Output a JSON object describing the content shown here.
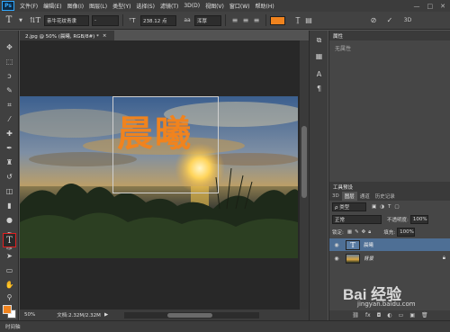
{
  "menu": {
    "logo": "Ps",
    "items": [
      "文件(F)",
      "编辑(E)",
      "图像(I)",
      "图层(L)",
      "类型(Y)",
      "选择(S)",
      "滤镜(T)",
      "3D(D)",
      "视图(V)",
      "窗口(W)",
      "帮助(H)"
    ]
  },
  "options": {
    "font_family": "亲牛花纹青隶",
    "font_style": "-",
    "font_size": "238.12 点",
    "antialias": "浑厚",
    "text_color": "#f0831e"
  },
  "document": {
    "tab_title": "2.jpg @ 50% (晨曦, RGB/8#) *",
    "text_layer": "晨曦",
    "zoom": "50%",
    "doc_info": "文档:2.32M/2.32M"
  },
  "properties": {
    "title": "属性",
    "empty_text": "无属性"
  },
  "layers_panel": {
    "preset_tab": "工具预设",
    "tabs": [
      "3D",
      "图层",
      "通道",
      "历史记录"
    ],
    "filter_label": "ρ 类型",
    "blend_mode": "正常",
    "opacity_label": "不透明度:",
    "opacity_value": "100%",
    "lock_label": "锁定:",
    "fill_label": "填充:",
    "fill_value": "100%",
    "layers": [
      {
        "name": "晨曦",
        "selected": true
      },
      {
        "name": "背景",
        "selected": false
      }
    ]
  },
  "bottom_panel": "时间轴",
  "watermark": {
    "logo": "Bai 经验",
    "url": "jingyan.baidu.com"
  },
  "colors": {
    "accent_orange": "#f0831e",
    "highlight_red": "#e02020",
    "selected_layer": "#4e6f95"
  }
}
